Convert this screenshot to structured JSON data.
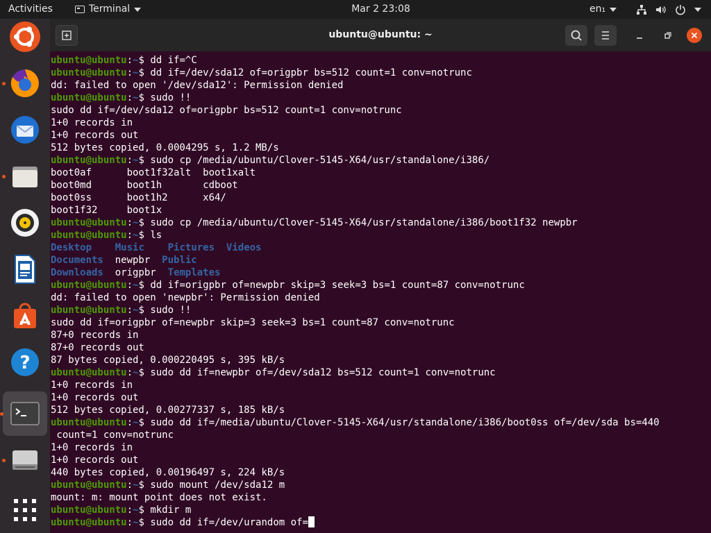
{
  "topbar": {
    "activities": "Activities",
    "app_menu": "Terminal",
    "clock": "Mar 2  23:08",
    "lang": "en₁"
  },
  "dock": {
    "items": [
      "ubuntu-logo-icon",
      "firefox-icon",
      "thunderbird-icon",
      "files-icon",
      "rhythmbox-icon",
      "libreoffice-writer-icon",
      "software-center-icon",
      "help-icon",
      "terminal-icon",
      "disk-icon",
      "show-apps-grid-icon"
    ]
  },
  "window": {
    "title": "ubuntu@ubuntu: ~"
  },
  "terminal": {
    "prompt_user": "ubuntu@ubuntu",
    "prompt_sep": ":",
    "prompt_path": "~",
    "prompt_sym": "$ ",
    "lines": [
      {
        "t": "p",
        "cmd": "dd if=^C"
      },
      {
        "t": "p",
        "cmd": "dd if=/dev/sda12 of=origpbr bs=512 count=1 conv=notrunc"
      },
      {
        "t": "o",
        "text": "dd: failed to open '/dev/sda12': Permission denied"
      },
      {
        "t": "p",
        "cmd": "sudo !!"
      },
      {
        "t": "o",
        "text": "sudo dd if=/dev/sda12 of=origpbr bs=512 count=1 conv=notrunc"
      },
      {
        "t": "o",
        "text": "1+0 records in"
      },
      {
        "t": "o",
        "text": "1+0 records out"
      },
      {
        "t": "o",
        "text": "512 bytes copied, 0.0004295 s, 1.2 MB/s"
      },
      {
        "t": "p",
        "cmd": "sudo cp /media/ubuntu/Clover-5145-X64/usr/standalone/i386/"
      },
      {
        "t": "o",
        "text": "boot0af      boot1f32alt  boot1xalt"
      },
      {
        "t": "o",
        "text": "boot0md      boot1h       cdboot"
      },
      {
        "t": "o",
        "text": "boot0ss      boot1h2      x64/"
      },
      {
        "t": "o",
        "text": "boot1f32     boot1x"
      },
      {
        "t": "p",
        "cmd": "sudo cp /media/ubuntu/Clover-5145-X64/usr/standalone/i386/boot1f32 newpbr"
      },
      {
        "t": "p",
        "cmd": "ls"
      },
      {
        "t": "ls",
        "items": [
          {
            "n": "Desktop",
            "d": true,
            "pad": "    "
          },
          {
            "n": "Music",
            "d": true,
            "pad": "    "
          },
          {
            "n": "Pictures",
            "d": true,
            "pad": "  "
          },
          {
            "n": "Videos",
            "d": true,
            "pad": ""
          }
        ]
      },
      {
        "t": "ls",
        "items": [
          {
            "n": "Documents",
            "d": true,
            "pad": "  "
          },
          {
            "n": "newpbr",
            "d": false,
            "pad": "  "
          },
          {
            "n": "Public",
            "d": true,
            "pad": ""
          }
        ]
      },
      {
        "t": "ls",
        "items": [
          {
            "n": "Downloads",
            "d": true,
            "pad": "  "
          },
          {
            "n": "origpbr",
            "d": false,
            "pad": "  "
          },
          {
            "n": "Templates",
            "d": true,
            "pad": ""
          }
        ]
      },
      {
        "t": "p",
        "cmd": "dd if=origpbr of=newpbr skip=3 seek=3 bs=1 count=87 conv=notrunc"
      },
      {
        "t": "o",
        "text": "dd: failed to open 'newpbr': Permission denied"
      },
      {
        "t": "p",
        "cmd": "sudo !!"
      },
      {
        "t": "o",
        "text": "sudo dd if=origpbr of=newpbr skip=3 seek=3 bs=1 count=87 conv=notrunc"
      },
      {
        "t": "o",
        "text": "87+0 records in"
      },
      {
        "t": "o",
        "text": "87+0 records out"
      },
      {
        "t": "o",
        "text": "87 bytes copied, 0.000220495 s, 395 kB/s"
      },
      {
        "t": "p",
        "cmd": "sudo dd if=newpbr of=/dev/sda12 bs=512 count=1 conv=notrunc"
      },
      {
        "t": "o",
        "text": "1+0 records in"
      },
      {
        "t": "o",
        "text": "1+0 records out"
      },
      {
        "t": "o",
        "text": "512 bytes copied, 0.00277337 s, 185 kB/s"
      },
      {
        "t": "p",
        "cmd": "sudo dd if=/media/ubuntu/Clover-5145-X64/usr/standalone/i386/boot0ss of=/dev/sda bs=440"
      },
      {
        "t": "o",
        "text": " count=1 conv=notrunc"
      },
      {
        "t": "o",
        "text": "1+0 records in"
      },
      {
        "t": "o",
        "text": "1+0 records out"
      },
      {
        "t": "o",
        "text": "440 bytes copied, 0.00196497 s, 224 kB/s"
      },
      {
        "t": "p",
        "cmd": "sudo mount /dev/sda12 m"
      },
      {
        "t": "o",
        "text": "mount: m: mount point does not exist."
      },
      {
        "t": "p",
        "cmd": "mkdir m"
      },
      {
        "t": "p",
        "cmd": "sudo dd if=/dev/urandom of=",
        "cursor": true
      }
    ]
  }
}
